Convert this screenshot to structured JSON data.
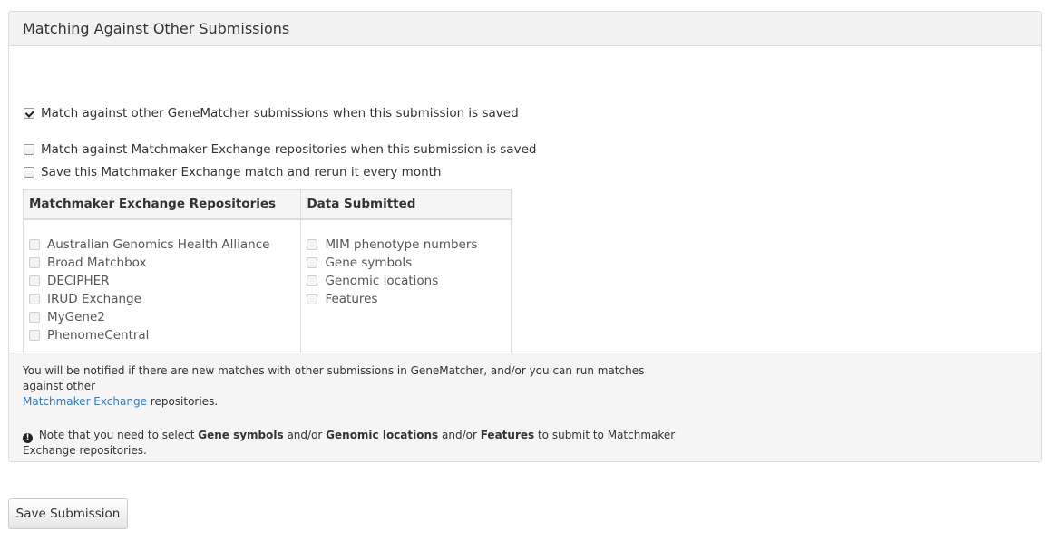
{
  "panel": {
    "title": "Matching Against Other Submissions"
  },
  "options": {
    "genematcher": {
      "label": "Match against other GeneMatcher submissions when this submission is saved",
      "checked": true
    },
    "mme": {
      "label": "Match against Matchmaker Exchange repositories when this submission is saved",
      "checked": false
    },
    "monthly": {
      "label": "Save this Matchmaker Exchange match and rerun it every month",
      "checked": false
    }
  },
  "table": {
    "col1_header": "Matchmaker Exchange Repositories",
    "col2_header": "Data Submitted",
    "repositories": [
      "Australian Genomics Health Alliance",
      "Broad Matchbox",
      "DECIPHER",
      "IRUD Exchange",
      "MyGene2",
      "PhenomeCentral"
    ],
    "data_types": [
      "MIM phenotype numbers",
      "Gene symbols",
      "Genomic locations",
      "Features"
    ]
  },
  "footer": {
    "line1_pre": "You will be notified if there are new matches with other submissions in GeneMatcher, and/or you can run matches against other",
    "link_text": "Matchmaker Exchange",
    "line1_post": " repositories.",
    "note_pre": " Note that you need to select ",
    "note_b1": "Gene symbols",
    "note_mid1": " and/or ",
    "note_b2": "Genomic locations",
    "note_mid2": " and/or ",
    "note_b3": "Features",
    "note_post": " to submit to Matchmaker Exchange repositories."
  },
  "actions": {
    "save_label": "Save Submission"
  },
  "icons": {
    "info": "exclamation-circle-icon"
  }
}
